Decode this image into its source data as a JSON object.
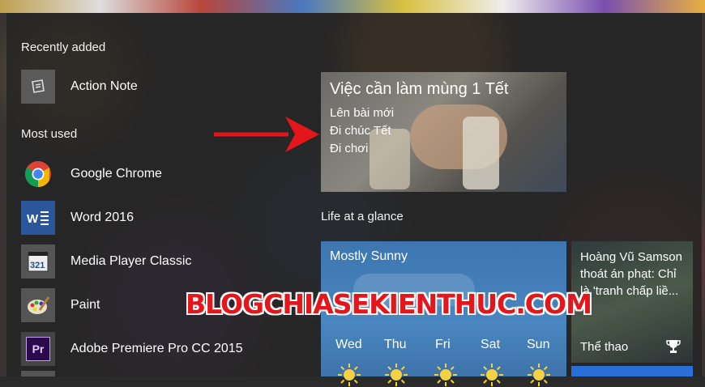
{
  "sections": {
    "recently_added": "Recently added",
    "most_used": "Most used",
    "life_at_a_glance": "Life at a glance"
  },
  "apps": {
    "action_note": "Action Note",
    "chrome": "Google Chrome",
    "word": "Word 2016",
    "mpc": "Media Player Classic",
    "paint": "Paint",
    "premiere": "Adobe Premiere Pro CC 2015"
  },
  "todo_tile": {
    "title": "Việc cần làm mùng 1 Tết",
    "lines": [
      "Lên bài mới",
      "Đi chúc Tết",
      "Đi chơi"
    ]
  },
  "weather_tile": {
    "condition": "Mostly Sunny",
    "days": [
      "Wed",
      "Thu",
      "Fri",
      "Sat",
      "Sun"
    ]
  },
  "sports_tile": {
    "headline": "Hoàng Vũ Samson thoát án phạt: Chỉ là 'tranh chấp liề...",
    "category": "Thể thao"
  },
  "watermark": "BLOGCHIASEKIENTHUC.COM",
  "colors": {
    "arrow": "#e3171b",
    "weather_bg": "#4a86c0",
    "word_blue": "#2b579a",
    "premiere_purple": "#2a0a4a"
  }
}
